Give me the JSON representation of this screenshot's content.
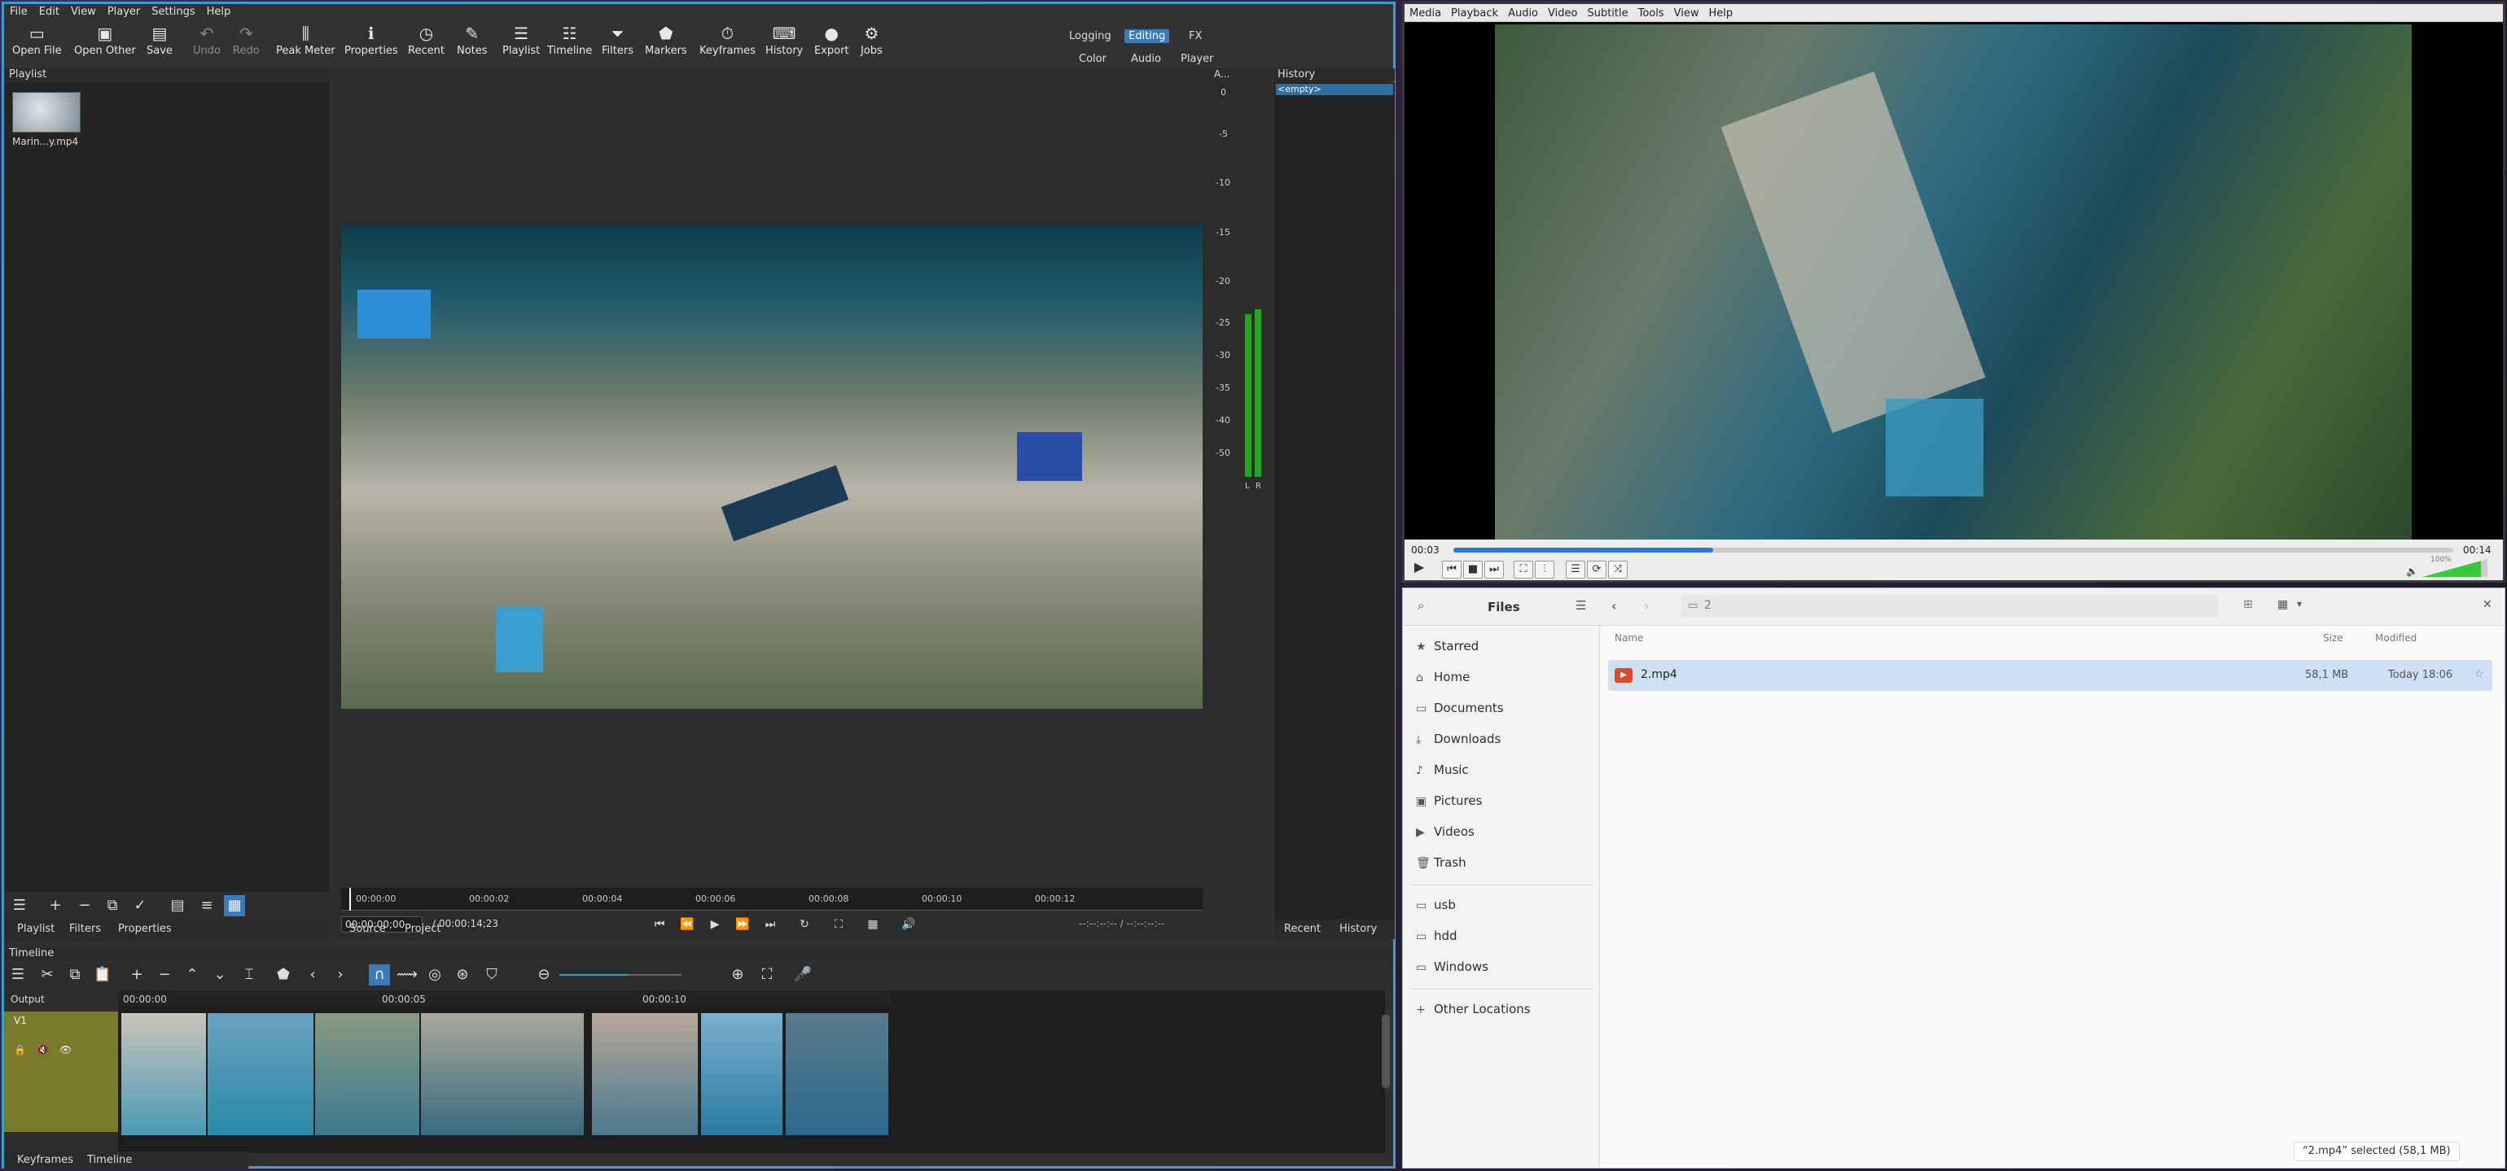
{
  "shotcut": {
    "menu": [
      "File",
      "Edit",
      "View",
      "Player",
      "Settings",
      "Help"
    ],
    "toolbar": [
      {
        "label": "Open File",
        "icon": "folder-open-icon",
        "enabled": true
      },
      {
        "label": "Open Other",
        "icon": "open-other-icon",
        "enabled": true
      },
      {
        "label": "Save",
        "icon": "save-icon",
        "enabled": true
      },
      {
        "label": "Undo",
        "icon": "undo-icon",
        "enabled": false
      },
      {
        "label": "Redo",
        "icon": "redo-icon",
        "enabled": false
      },
      {
        "label": "Peak Meter",
        "icon": "peak-meter-icon",
        "enabled": true
      },
      {
        "label": "Properties",
        "icon": "info-icon",
        "enabled": true
      },
      {
        "label": "Recent",
        "icon": "clock-icon",
        "enabled": true
      },
      {
        "label": "Notes",
        "icon": "notes-icon",
        "enabled": true
      },
      {
        "label": "Playlist",
        "icon": "list-icon",
        "enabled": true
      },
      {
        "label": "Timeline",
        "icon": "timeline-icon",
        "enabled": true
      },
      {
        "label": "Filters",
        "icon": "filter-icon",
        "enabled": true
      },
      {
        "label": "Markers",
        "icon": "marker-icon",
        "enabled": true
      },
      {
        "label": "Keyframes",
        "icon": "stopwatch-icon",
        "enabled": true
      },
      {
        "label": "History",
        "icon": "history-icon",
        "enabled": true
      },
      {
        "label": "Export",
        "icon": "export-icon",
        "enabled": true
      },
      {
        "label": "Jobs",
        "icon": "gear-icon",
        "enabled": true
      }
    ],
    "layouts": {
      "logging": "Logging",
      "editing": "Editing",
      "fx": "FX",
      "color": "Color",
      "audio": "Audio",
      "player": "Player"
    },
    "playlist": {
      "title": "Playlist",
      "item": "Marin...y.mp4",
      "tabs": [
        "Playlist",
        "Filters",
        "Properties"
      ]
    },
    "meter": {
      "title": "A...",
      "scale": [
        "0",
        "-5",
        "-10",
        "-15",
        "-20",
        "-25",
        "-30",
        "-35",
        "-40",
        "-50"
      ],
      "left": "L",
      "right": "R"
    },
    "history": {
      "title": "History",
      "item": "<empty>",
      "tabs": [
        "Recent",
        "History"
      ]
    },
    "ruler": [
      "00:00:00",
      "00:00:02",
      "00:00:04",
      "00:00:06",
      "00:00:08",
      "00:00:10",
      "00:00:12"
    ],
    "timecode": "00:00:00;00",
    "duration": "/ 00:00:14;23",
    "in_out": "--:--:--:-- / --:--:--:--",
    "source_tabs": [
      "Source",
      "Project"
    ],
    "timeline": {
      "title": "Timeline",
      "output": "Output",
      "track": "V1",
      "ruler": [
        "00:00:00",
        "00:00:05",
        "00:00:10"
      ],
      "tabs": [
        "Keyframes",
        "Timeline"
      ]
    }
  },
  "vlc": {
    "menu": [
      "Media",
      "Playback",
      "Audio",
      "Video",
      "Subtitle",
      "Tools",
      "View",
      "Help"
    ],
    "elapsed": "00:03",
    "total": "00:14",
    "progress": 0.26,
    "volume": "100%"
  },
  "files": {
    "title": "Files",
    "path": "2",
    "places": [
      "Starred",
      "Home",
      "Documents",
      "Downloads",
      "Music",
      "Pictures",
      "Videos",
      "Trash"
    ],
    "devices": [
      "usb",
      "hdd",
      "Windows"
    ],
    "other": "Other Locations",
    "columns": {
      "name": "Name",
      "size": "Size",
      "modified": "Modified"
    },
    "rows": [
      {
        "name": "2.mp4",
        "size": "58,1 MB",
        "modified": "Today 18:06"
      }
    ],
    "status": "“2.mp4” selected (58,1 MB)"
  }
}
